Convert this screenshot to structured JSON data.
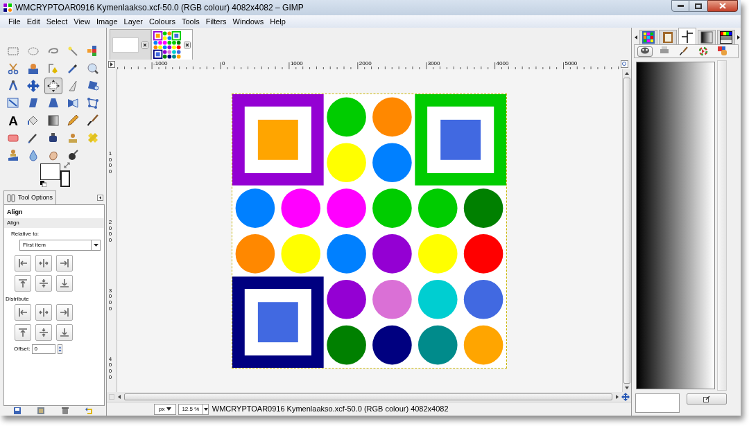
{
  "window": {
    "title": "WMCRYPTOAR0916 Kymenlaakso.xcf-50.0 (RGB colour) 4082x4082 – GIMP"
  },
  "menu": [
    "File",
    "Edit",
    "Select",
    "View",
    "Image",
    "Layer",
    "Colours",
    "Tools",
    "Filters",
    "Windows",
    "Help"
  ],
  "toolbox": {
    "tools": [
      {
        "selected": false
      },
      {
        "selected": false
      },
      {
        "selected": false
      },
      {
        "selected": false
      },
      {
        "selected": false
      },
      {
        "selected": false
      },
      {
        "selected": false
      },
      {
        "selected": false
      },
      {
        "selected": false
      },
      {
        "selected": false
      },
      {
        "selected": false
      },
      {
        "selected": false
      },
      {
        "selected": true
      },
      {
        "selected": false
      },
      {
        "selected": false
      },
      {
        "selected": false
      },
      {
        "selected": false
      },
      {
        "selected": false
      },
      {
        "selected": false
      },
      {
        "selected": false
      },
      {
        "selected": false,
        "label": "A"
      },
      {
        "selected": false
      },
      {
        "selected": false
      },
      {
        "selected": false
      },
      {
        "selected": false
      },
      {
        "selected": false
      },
      {
        "selected": false
      },
      {
        "selected": false
      },
      {
        "selected": false
      },
      {
        "selected": false
      },
      {
        "selected": false
      },
      {
        "selected": false
      },
      {
        "selected": false
      },
      {
        "selected": false
      }
    ]
  },
  "tool_options": {
    "tab": "Tool Options",
    "title": "Align",
    "section": "Align",
    "relative_label": "Relative to:",
    "relative_value": "First item",
    "distribute_label": "Distribute",
    "offset_label": "Offset:",
    "offset_value": "0"
  },
  "image_tabs": [
    {
      "selected": false
    },
    {
      "selected": true
    }
  ],
  "rulers": {
    "horizontal": [
      "-1000",
      "0",
      "1000",
      "2000",
      "3000",
      "4000",
      "5000"
    ],
    "vertical": [
      "1000",
      "2000",
      "3000",
      "4000"
    ]
  },
  "status_bar": {
    "unit": "px",
    "zoom": "12.5 %",
    "title": "WMCRYPTOAR0916 Kymenlaakso.xcf-50.0 (RGB colour) 4082x4082"
  },
  "dock_toolbar": [
    {
      "selected": true
    },
    {
      "selected": false
    },
    {
      "selected": false
    },
    {
      "selected": false
    },
    {
      "selected": false
    }
  ],
  "dock_tabs": [
    {
      "selected": false
    },
    {
      "selected": false
    },
    {
      "selected": true
    },
    {
      "selected": false
    },
    {
      "selected": false
    }
  ]
}
